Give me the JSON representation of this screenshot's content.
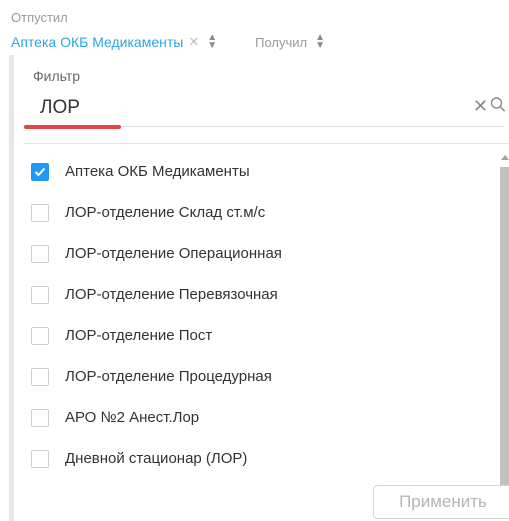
{
  "header": {
    "sender_label": "Отпустил",
    "sender_value": "Аптека ОКБ Медикаменты",
    "clear_glyph": "✕",
    "receiver_label": "Получил"
  },
  "filter": {
    "label": "Фильтр",
    "value": "ЛОР",
    "clear_glyph": "✕",
    "search_icon": "search-icon",
    "focus_color": "#e8424a"
  },
  "options": [
    {
      "label": "Аптека ОКБ Медикаменты",
      "checked": true
    },
    {
      "label": "ЛОР-отделение Склад ст.м/с",
      "checked": false
    },
    {
      "label": "ЛОР-отделение Операционная",
      "checked": false
    },
    {
      "label": "ЛОР-отделение Перевязочная",
      "checked": false
    },
    {
      "label": "ЛОР-отделение Пост",
      "checked": false
    },
    {
      "label": "ЛОР-отделение Процедурная",
      "checked": false
    },
    {
      "label": "АРО №2 Анест.Лор",
      "checked": false
    },
    {
      "label": "Дневной стационар (ЛОР)",
      "checked": false
    }
  ],
  "apply_button": {
    "label": "Применить",
    "disabled": true
  },
  "colors": {
    "accent": "#29a8e0",
    "checkbox": "#2196f3"
  }
}
